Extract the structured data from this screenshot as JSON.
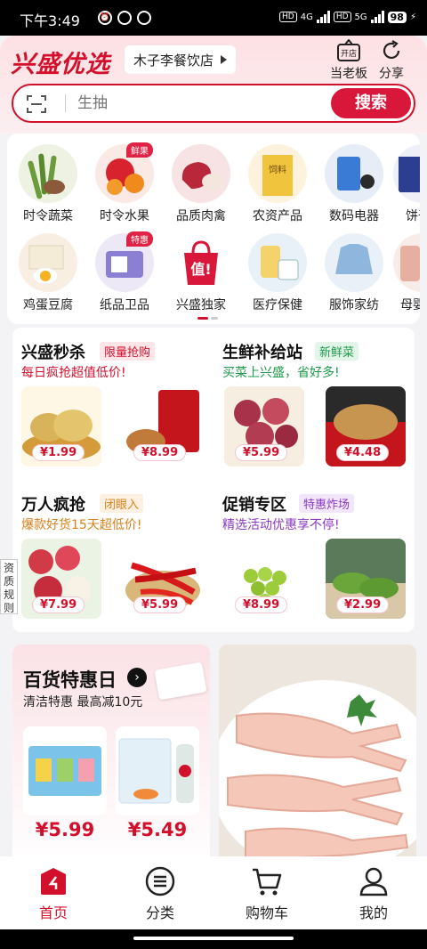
{
  "status": {
    "time": "下午3:49",
    "net": "4G",
    "net2": "5G",
    "hd": "HD",
    "battery": "98"
  },
  "header": {
    "logo": "兴盛优选",
    "store": "木子李餐饮店",
    "owner_btn": "当老板",
    "owner_icon_text": "开店",
    "share_btn": "分享"
  },
  "search": {
    "placeholder": "生抽",
    "button": "搜索"
  },
  "categories": [
    {
      "label": "时令蔬菜",
      "badge": ""
    },
    {
      "label": "时令水果",
      "badge": "鲜果"
    },
    {
      "label": "品质肉禽",
      "badge": ""
    },
    {
      "label": "农资产品",
      "badge": "",
      "img_text": "饲料"
    },
    {
      "label": "数码电器",
      "badge": ""
    },
    {
      "label": "饼干",
      "badge": ""
    },
    {
      "label": "鸡蛋豆腐",
      "badge": ""
    },
    {
      "label": "纸品卫品",
      "badge": "特惠"
    },
    {
      "label": "兴盛独家",
      "badge": "",
      "img_text": "值!"
    },
    {
      "label": "医疗保健",
      "badge": ""
    },
    {
      "label": "服饰家纺",
      "badge": ""
    },
    {
      "label": "母婴",
      "badge": ""
    }
  ],
  "promos": [
    {
      "title": "兴盛秒杀",
      "tag": "限量抢购",
      "sub": "每日疯抢超值低价!",
      "prices": [
        "¥1.99",
        "¥8.99"
      ]
    },
    {
      "title": "生鲜补给站",
      "tag": "新鲜菜",
      "sub": "买菜上兴盛，省好多!",
      "prices": [
        "¥5.99",
        "¥4.48"
      ]
    },
    {
      "title": "万人疯抢",
      "tag": "闭眼入",
      "sub": "爆款好货15天超低价!",
      "prices": [
        "¥7.99",
        "¥5.99"
      ]
    },
    {
      "title": "促销专区",
      "tag": "特惠炸场",
      "sub": "精选活动优惠享不停!",
      "prices": [
        "¥8.99",
        "¥2.99"
      ]
    }
  ],
  "side_label": "资质规则",
  "daily": {
    "title": "百货特惠日",
    "sub": "清洁特惠 最高减10元",
    "prices": [
      "¥5.99",
      "¥5.49"
    ]
  },
  "tabs": [
    {
      "label": "首页"
    },
    {
      "label": "分类"
    },
    {
      "label": "购物车"
    },
    {
      "label": "我的"
    }
  ],
  "colors": {
    "brand": "#d3102c",
    "bg": "#f3f3f5"
  }
}
